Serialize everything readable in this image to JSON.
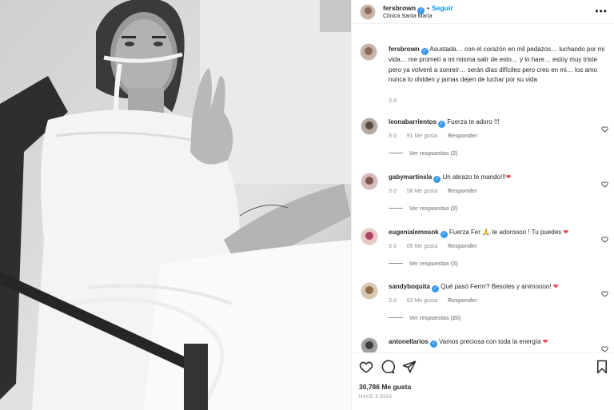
{
  "post": {
    "username": "fersbrown",
    "follow_label": "Seguir",
    "location": "Clínica Santa María",
    "caption": "Asustada… con el corazón en mil pedazos… luchando por mi vida… me prometí a mi misma salir de esto… y lo hare… estoy muy triste pero ya volveré a sonreír… serán días difíciles pero creo en mi… los amo nunca lo olviden y jamas dejen de luchar por su vida",
    "caption_time": "3 d",
    "likes": "30,786 Me gusta",
    "time_ago": "HACE 3 DÍAS"
  },
  "comments": [
    {
      "user": "leonabarrientos",
      "text": "Fuerza te adoro !!!",
      "heart": "",
      "time": "3 d",
      "likes": "91 Me gusta",
      "reply": "Responder",
      "replies": "Ver respuestas (2)"
    },
    {
      "user": "gabymartinsla",
      "text": "Un abrazo te mando!!!",
      "heart": "❤",
      "time": "3 d",
      "likes": "58 Me gusta",
      "reply": "Responder",
      "replies": "Ver respuestas (2)"
    },
    {
      "user": "eugenialemosok",
      "text": "Fuerza Fer 🙏 te adoroooo ! Tu puedes",
      "heart": "❤",
      "time": "3 d",
      "likes": "69 Me gusta",
      "reply": "Responder",
      "replies": "Ver respuestas (3)"
    },
    {
      "user": "sandyboquita",
      "text": "Qué pasó Ferrrr? Besotes y animoooo!",
      "heart": "❤",
      "time": "3 d",
      "likes": "53 Me gusta",
      "reply": "Responder",
      "replies": "Ver respuestas (20)"
    },
    {
      "user": "antonellarios",
      "text": "Vamos preciosa con toda la energía",
      "heart": "❤",
      "time": "",
      "likes": "",
      "reply": "",
      "replies": ""
    }
  ],
  "icons": {
    "like": "heart-outline-icon",
    "comment": "comment-icon",
    "share": "paper-plane-icon",
    "save": "bookmark-icon",
    "more": "more-options-icon"
  },
  "colors": {
    "accent": "#0095f6",
    "verified": "#3897f0",
    "heart": "#ed4956",
    "muted": "#8e8e8e"
  }
}
